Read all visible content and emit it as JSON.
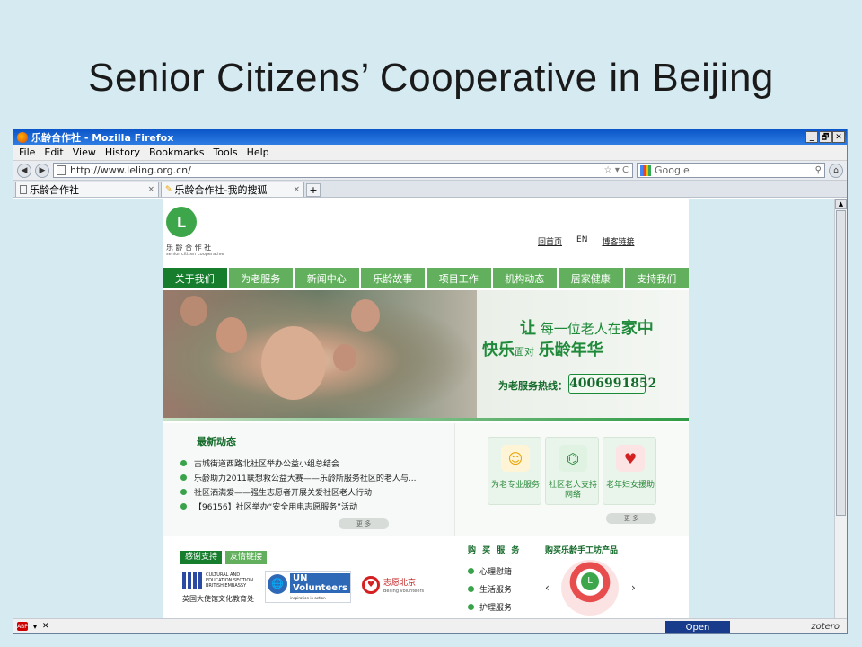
{
  "slide": {
    "title": "Senior Citizens’ Cooperative in Beijing"
  },
  "window": {
    "title": "乐龄合作社 - Mozilla Firefox",
    "controls": {
      "minimize": "_",
      "restore": "🗗",
      "close": "✕"
    },
    "menu": [
      "File",
      "Edit",
      "View",
      "History",
      "Bookmarks",
      "Tools",
      "Help"
    ],
    "nav": {
      "back": "◀",
      "forward": "▶",
      "home": "⌂"
    },
    "url": "http://www.leling.org.cn/",
    "url_icons": "☆ ▾ C",
    "search_placeholder": "Google",
    "search_icon": "magnifier-icon",
    "tabs": [
      {
        "label": "乐龄合作社",
        "close": "×"
      },
      {
        "label": "乐龄合作社-我的搜狐",
        "close": "×"
      }
    ],
    "new_tab": "+",
    "status": {
      "addon": "ABP",
      "open_button": "Open",
      "zotero": "zotero"
    }
  },
  "site": {
    "logo_glyph": "L",
    "logo_text": "乐 龄 合 作 社",
    "logo_sub": "senior citizen cooperative",
    "top_links": [
      "回首页",
      "EN",
      "博客链接"
    ],
    "nav": [
      "关于我们",
      "为老服务",
      "新闻中心",
      "乐龄故事",
      "项目工作",
      "机构动态",
      "居家健康",
      "支持我们"
    ],
    "active_nav": "关于我们",
    "banner": {
      "line1_big1": "让",
      "line1_small": "每一位老人在",
      "line1_big2": "家中",
      "line2_big1": "快乐",
      "line2_small": "面对",
      "line2_big2": "乐龄年华",
      "hotline_label": "为老服务热线：",
      "hotline": "4006991852"
    },
    "news": {
      "heading": "最新动态",
      "items": [
        "古城街道西路北社区举办公益小组总结会",
        "乐龄助力2011联想救公益大赛——乐龄所服务社区的老人与...",
        "社区洒满爱——强生志愿者开展关爱社区老人行动",
        "【96156】社区举办“安全用电志愿服务”活动"
      ],
      "more": "更 多"
    },
    "services": {
      "cards": [
        {
          "label": "为老专业服务",
          "icon": "nurse-icon"
        },
        {
          "label": "社区老人支持网络",
          "icon": "signal-tower-icon"
        },
        {
          "label": "老年妇女援助",
          "icon": "heart-magnifier-icon"
        }
      ],
      "more": "更 多"
    },
    "partners": {
      "tabs": [
        "感谢支持",
        "友情链接"
      ],
      "british": {
        "text": "CULTURAL AND EDUCATION SECTION BRITISH EMBASSY",
        "cn": "英国大使馆文化教育处"
      },
      "unv": {
        "title": "UN Volunteers",
        "sub": "inspiration in action"
      },
      "bv": {
        "title": "志愿北京",
        "sub": "Beijing volunteers"
      }
    },
    "buy": {
      "heading1": "购 买 服 务",
      "heading2": "购买乐龄手工坊产品",
      "items": [
        "心理慰籍",
        "生活服务",
        "护理服务"
      ],
      "prev": "‹",
      "next": "›"
    }
  }
}
